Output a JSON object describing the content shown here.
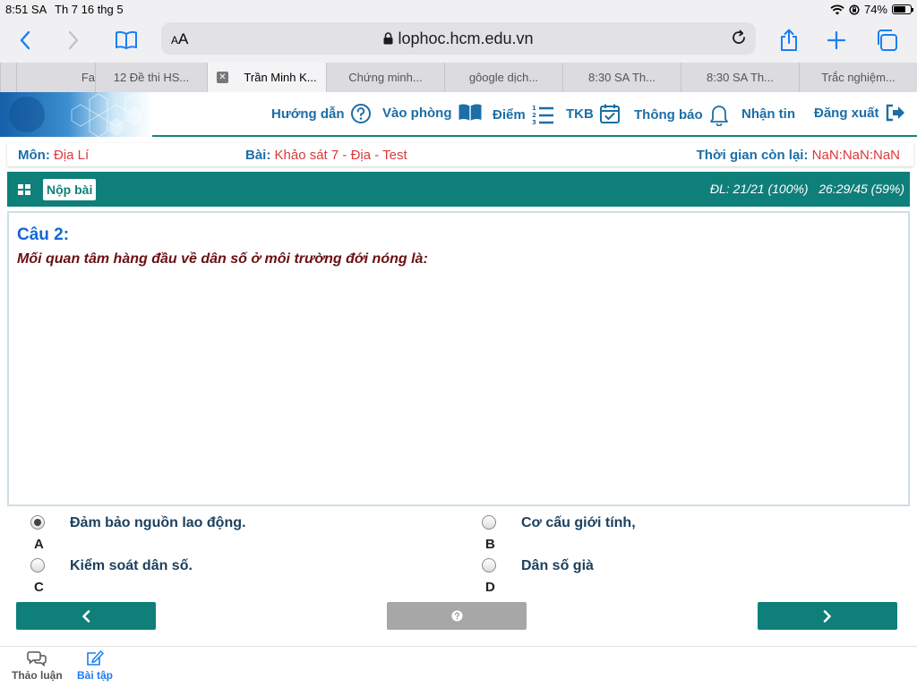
{
  "status_bar": {
    "time": "8:51 SA",
    "date": "Th 7 16 thg 5",
    "battery": "74%",
    "battery_level": 0.74
  },
  "browser": {
    "text_size_label_small": "A",
    "text_size_label_large": "A",
    "url": "lophoc.hcm.edu.vn",
    "tabs": [
      {
        "label": "Fa",
        "active": false
      },
      {
        "label": "12 Đề thi HS...",
        "active": false
      },
      {
        "label": "Trần Minh K...",
        "active": true
      },
      {
        "label": "Chứng minh...",
        "active": false
      },
      {
        "label": "gôogle dịch...",
        "active": false
      },
      {
        "label": "8:30 SA Th...",
        "active": false
      },
      {
        "label": "8:30 SA Th...",
        "active": false
      },
      {
        "label": "Trắc nghiệm...",
        "active": false
      }
    ]
  },
  "site_nav": {
    "guide": "Hướng dẫn",
    "join_room": "Vào phòng",
    "scores": "Điểm",
    "timetable": "TKB",
    "notifications": "Thông báo",
    "messages": "Nhận tin",
    "logout": "Đăng xuất"
  },
  "exam_info": {
    "subject_label": "Môn:",
    "subject": "Địa Lí",
    "lesson_label": "Bài:",
    "lesson": "Khảo sát 7 - Địa - Test",
    "time_left_label": "Thời gian còn lại:",
    "time_left": "NaN:NaN:NaN"
  },
  "exam_bar": {
    "submit_label": "Nộp bài",
    "progress": "ĐL: 21/21 (100%)",
    "time_progress": "26:29/45 (59%)"
  },
  "question": {
    "title": "Câu 2:",
    "text": "Mối quan tâm hàng đầu về dân số ở môi trường đới nóng là:"
  },
  "answers": [
    {
      "letter": "A",
      "text": "Đảm bảo nguồn lao động.",
      "selected": true
    },
    {
      "letter": "B",
      "text": "Cơ cấu giới tính,",
      "selected": false
    },
    {
      "letter": "C",
      "text": "Kiểm soát dân số.",
      "selected": false
    },
    {
      "letter": "D",
      "text": "Dân số già",
      "selected": false
    }
  ],
  "bottom_nav": {
    "discussion": "Thảo luận",
    "exercises": "Bài tập"
  },
  "colors": {
    "teal": "#0f7f7a",
    "nav_blue": "#1b6ea6",
    "question_title": "#1467d6",
    "question_text": "#6b0f12",
    "value_red": "#d93a3a",
    "ios_blue": "#1a7ef5"
  }
}
